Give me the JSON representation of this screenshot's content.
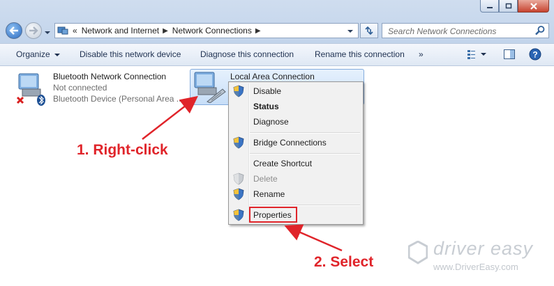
{
  "window": {
    "caption_buttons": {
      "minimize_icon": "minimize-icon",
      "maximize_icon": "maximize-icon",
      "close_icon": "close-icon"
    }
  },
  "address_bar": {
    "overflow": "«",
    "breadcrumbs": [
      "Network and Internet",
      "Network Connections"
    ],
    "search_placeholder": "Search Network Connections"
  },
  "toolbar": {
    "organize": "Organize",
    "disable": "Disable this network device",
    "diagnose": "Diagnose this connection",
    "rename": "Rename this connection",
    "more": "»",
    "help": "?"
  },
  "connections": [
    {
      "name": "Bluetooth Network Connection",
      "status": "Not connected",
      "device": "Bluetooth Device (Personal Area ..."
    },
    {
      "name": "Local Area Connection"
    }
  ],
  "context_menu": {
    "items": [
      {
        "label": "Disable",
        "icon": "shield-icon"
      },
      {
        "label": "Status",
        "bold": true
      },
      {
        "label": "Diagnose"
      },
      {
        "label": "Bridge Connections",
        "icon": "shield-icon"
      },
      {
        "label": "Create Shortcut"
      },
      {
        "label": "Delete",
        "icon": "shield-icon",
        "disabled": true
      },
      {
        "label": "Rename",
        "icon": "shield-icon"
      },
      {
        "label": "Properties",
        "icon": "shield-icon",
        "highlighted": true
      }
    ]
  },
  "annotations": {
    "step1": "1. Right-click",
    "step2": "2. Select"
  },
  "watermark": {
    "brand": "driver easy",
    "url": "www.DriverEasy.com"
  },
  "colors": {
    "annotation_red": "#e0242a",
    "selection_blue": "#c7def8",
    "toolbar_text": "#1e3050"
  }
}
